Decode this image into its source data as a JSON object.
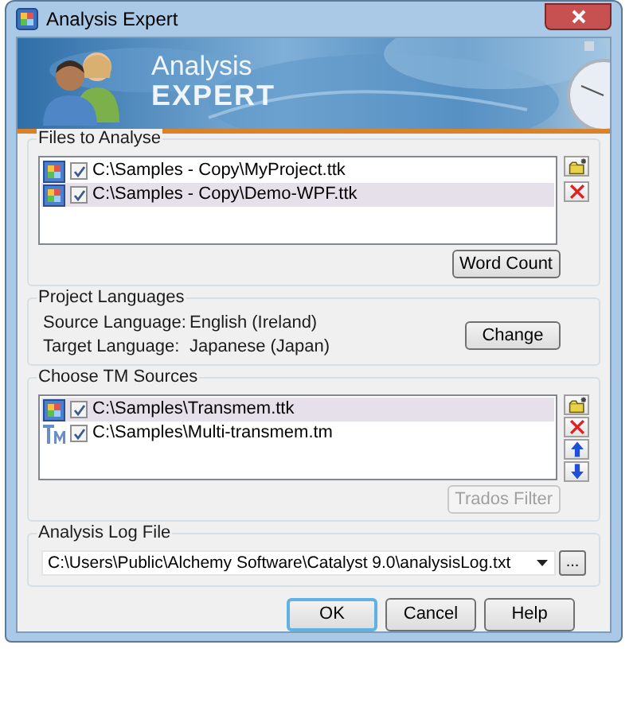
{
  "window": {
    "title": "Analysis Expert"
  },
  "banner": {
    "line_1": "Analysis",
    "line_2": "EXPERT"
  },
  "files": {
    "label": "Files to Analyse",
    "items": [
      {
        "kind": "project",
        "path": "C:\\Samples - Copy\\MyProject.ttk",
        "checked": true,
        "selected": false
      },
      {
        "kind": "project",
        "path": "C:\\Samples - Copy\\Demo-WPF.ttk",
        "checked": true,
        "selected": true
      }
    ],
    "tools": [
      {
        "kind": "add"
      },
      {
        "kind": "remove"
      }
    ],
    "button": {
      "label": "Word Count",
      "disabled": false
    }
  },
  "languages": {
    "label": "Project Languages",
    "rows": [
      {
        "label": "Source Language:",
        "value": "English (Ireland)"
      },
      {
        "label": "Target Language:",
        "value": "Japanese (Japan)"
      }
    ],
    "button": {
      "label": "Change",
      "disabled": false
    }
  },
  "tm_sources": {
    "label": "Choose TM Sources",
    "items": [
      {
        "kind": "project",
        "path": "C:\\Samples\\Transmem.ttk",
        "checked": true,
        "selected": true
      },
      {
        "kind": "tm",
        "path": "C:\\Samples\\Multi-transmem.tm",
        "checked": true,
        "selected": false
      }
    ],
    "tools": [
      {
        "kind": "add"
      },
      {
        "kind": "remove"
      },
      {
        "kind": "up"
      },
      {
        "kind": "down"
      }
    ],
    "button": {
      "label": "Trados Filter",
      "disabled": true
    }
  },
  "log_file": {
    "label": "Analysis Log File",
    "value": "C:\\Users\\Public\\Alchemy Software\\Catalyst 9.0\\analysisLog.txt",
    "browse": "..."
  },
  "buttons": [
    {
      "label": "OK",
      "default": true
    },
    {
      "label": "Cancel",
      "default": false
    },
    {
      "label": "Help",
      "default": false
    }
  ]
}
